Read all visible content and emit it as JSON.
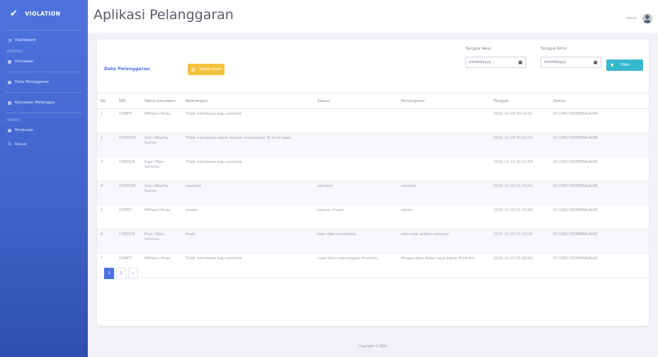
{
  "sidebar": {
    "brand": "VIOLATION",
    "items": [
      {
        "label": "Dashboard",
        "icon": "dashboard-icon"
      },
      {
        "heading": "INTERFACE"
      },
      {
        "label": "Karyawan",
        "icon": "table-icon"
      },
      {
        "label": "Data Pelanggaran",
        "icon": "table-icon"
      },
      {
        "label": "Karyawan Melanggar",
        "icon": "table-icon"
      },
      {
        "heading": "ADDONS"
      },
      {
        "label": "Peraturan",
        "icon": "table-icon"
      },
      {
        "label": "Keluar",
        "icon": "logout-icon"
      }
    ]
  },
  "header": {
    "title": "Aplikasi Pelanggaran",
    "user": "Admin"
  },
  "card": {
    "title": "Data Pelanggaran",
    "export_label": "Export Excel",
    "start_label": "Tanggal Awal",
    "end_label": "Tanggal Akhir",
    "date_placeholder": "mm/dd/yyyy",
    "filter_label": "Filter"
  },
  "table": {
    "headers": [
      "No",
      "NID",
      "Nama karyawan",
      "Keterangan",
      "Alasan",
      "Persangatan",
      "Tanggal",
      "Status"
    ],
    "rows": [
      [
        "1",
        "D3MFY",
        "Miftahul Huda",
        "Tidak membawa baju produksi",
        "",
        "",
        "2021-10-18 20:10:41",
        "ID CARD DIKEMBALIKAN"
      ],
      [
        "2",
        "D2DHUPI",
        "Dutu Wisdha Sairoo",
        "Tidak membawa sabuk tempat menyimpan ID Card swak",
        "",
        "",
        "2021-11-20 20:10:43",
        "ID CARD DIKEMBALIKAN"
      ],
      [
        "3",
        "D3RDLM",
        "Erga Tiban Santoso",
        "Tidak membawa baju produksi",
        "",
        "",
        "2021-11-10 20:11:54",
        "ID CARD DIKEMBALIKAN"
      ],
      [
        "4",
        "D2DHUPI",
        "Dutu Wisdha Sairoo",
        "merokok",
        "merokok",
        "merokok",
        "2021-11-20 21:29:42",
        "ID CARD DIKEMBALIKAN"
      ],
      [
        "5",
        "D3MFY",
        "Miftahul Huda",
        "zhewh",
        "kalema zhewh",
        "zhewy",
        "2021-11-20 21:29:43",
        "ID CARD DIKEMBALIKAN"
      ],
      [
        "6",
        "D3RDLM",
        "Erga Tiban Santoso",
        "Mudo",
        "kala tidak membawa",
        "mencatat jadwal sewajarn",
        "2021-11-20 21:29:28",
        "ID CARD DIKEMBALIKAN"
      ],
      [
        "7",
        "D3MFY",
        "Miftahul Huda",
        "Tidak membawa baju produksi",
        "Lupa Kalau hara bagian Produksi",
        "Mengecakan Kalau saya bukan Produksi",
        "2021-11-24 01:08:52",
        "ID CARD DIKEMBALIKAN"
      ]
    ]
  },
  "pagination": {
    "current": "1",
    "next": "2",
    "arrow": "»"
  },
  "footer": "Copyright © 2021",
  "colors": {
    "primary": "#4e73df",
    "warning": "#f6c23e",
    "info": "#36b9cc"
  }
}
